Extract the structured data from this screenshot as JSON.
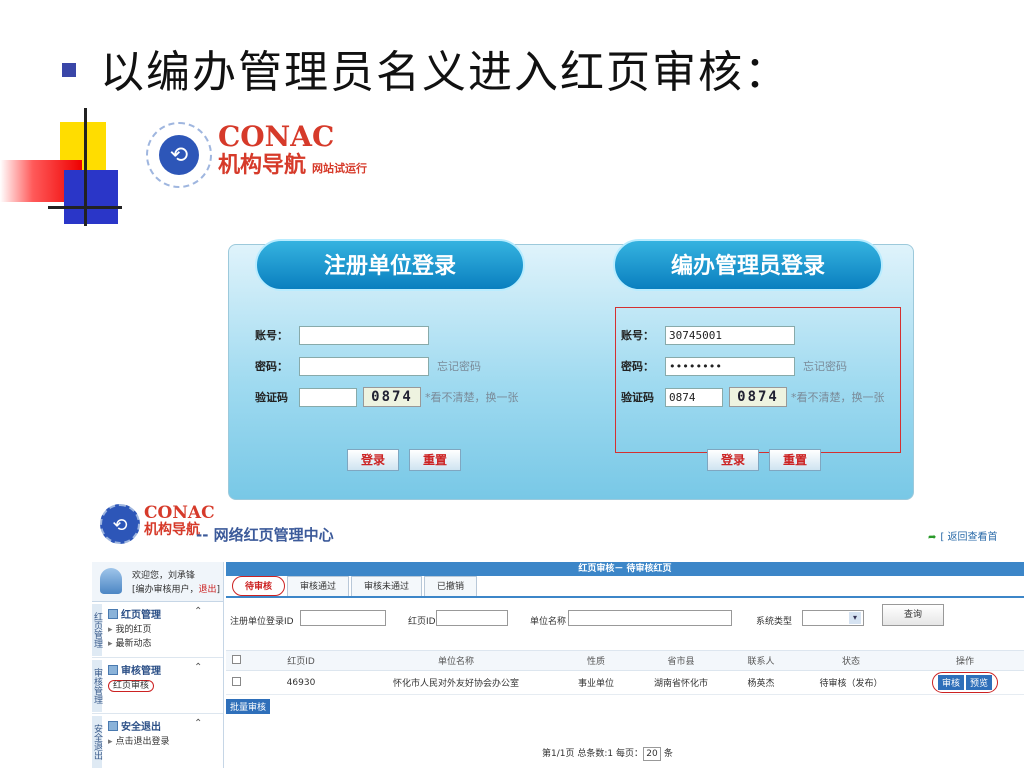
{
  "slide": {
    "heading": "以编办管理员名义进入红页审核："
  },
  "logo": {
    "en": "CONAC",
    "cn": "机构导航",
    "sub": "网站试运行"
  },
  "login": {
    "left_title": "注册单位登录",
    "right_title": "编办管理员登录",
    "account_label": "账号：",
    "password_label": "密码：",
    "captcha_label": "验证码",
    "remember_label": "忘记密码",
    "captcha_image_text": "0874",
    "captcha_hint": "*看不清楚，换一张",
    "left_account_value": "",
    "right_account_value": "30745001",
    "right_password_value": "••••••••",
    "right_captcha_value": "0874",
    "login_button": "登录",
    "reset_button": "重置"
  },
  "admin": {
    "logo_en": "CONAC",
    "logo_cn": "机构导航",
    "title": "-- 网络红页管理中心",
    "back_link": "[ 返回查看首",
    "welcome": "欢迎您，刘承锋",
    "user_role": "[编办审核用户，",
    "logout_link": "退出",
    "logout_bracket": "]",
    "sidebar": [
      {
        "tag": "红页管理",
        "head": "红页管理",
        "items": [
          "我的红页",
          "最新动态"
        ]
      },
      {
        "tag": "审核管理",
        "head": "审核管理",
        "items": [
          "红页审核"
        ]
      },
      {
        "tag": "安全退出",
        "head": "安全退出",
        "items": [
          "点击退出登录"
        ]
      }
    ],
    "main_bar": "红页审核－ 待审核红页",
    "tabs": [
      "待审核",
      "审核通过",
      "审核未通过",
      "已撤销"
    ],
    "filter": {
      "id_label": "注册单位登录ID",
      "page_id_label": "红页ID",
      "unit_label": "单位名称",
      "system_label": "系统类型",
      "query_button": "查询"
    },
    "table": {
      "headers": [
        "",
        "红页ID",
        "单位名称",
        "性质",
        "省市县",
        "联系人",
        "状态",
        "操作"
      ],
      "rows": [
        {
          "id": "46930",
          "unit": "怀化市人民对外友好协会办公室",
          "type": "事业单位",
          "region": "湖南省怀化市",
          "contact": "杨英杰",
          "status": "待审核（发布）"
        }
      ],
      "op_review": "审核",
      "op_preview": "预览"
    },
    "batch_button": "批量审核",
    "pager": {
      "prefix": "第1/1页 总条数:1 每页：",
      "per_page": "20",
      "suffix": "条"
    }
  }
}
